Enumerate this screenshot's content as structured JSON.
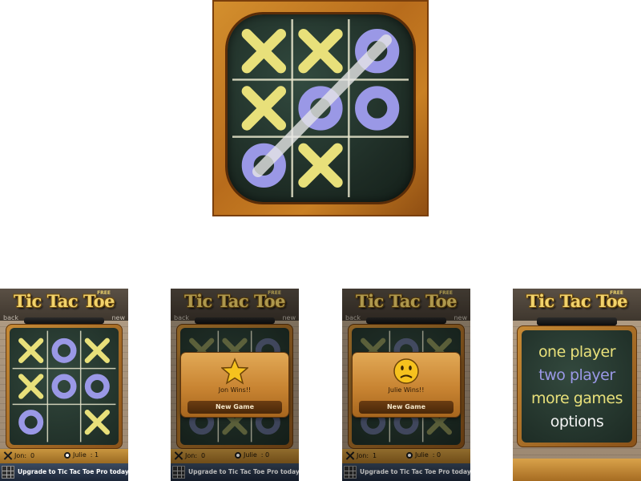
{
  "colors": {
    "x_color": "#e8e07a",
    "o_color": "#9a98e6",
    "chalk_line": "#e8e6cc",
    "board_green": "#22332a"
  },
  "app_icon": {
    "board": [
      "X",
      "X",
      "O",
      "X",
      "O",
      "O",
      "O",
      "X",
      ""
    ],
    "win_line": "diagonal-top-right-to-bottom-left"
  },
  "screen_game": {
    "logo": "Tic Tac Toe",
    "badge": "FREE",
    "nav_back": "back",
    "nav_new": "new",
    "board": [
      "X",
      "O",
      "X",
      "X",
      "O",
      "O",
      "O",
      "",
      "X"
    ],
    "player1": {
      "name": "Jon:",
      "score": "0"
    },
    "player2": {
      "name": "Julie",
      "score": ": 1"
    },
    "upgrade_text": "Upgrade to Tic Tac Toe Pro today!"
  },
  "screen_jon_wins": {
    "logo": "Tic Tac Toe",
    "badge": "FREE",
    "nav_back": "back",
    "nav_new": "new",
    "message": "Jon Wins!!",
    "button": "New Game",
    "icon": "star-icon",
    "player1": {
      "name": "Jon:",
      "score": "0"
    },
    "player2": {
      "name": "Julie",
      "score": ": 0"
    },
    "upgrade_text": "Upgrade to Tic Tac Toe Pro today!"
  },
  "screen_julie_wins": {
    "logo": "Tic Tac Toe",
    "badge": "FREE",
    "nav_back": "back",
    "nav_new": "new",
    "message": "Julie   Wins!!",
    "button": "New Game",
    "icon": "sad-face-icon",
    "player1": {
      "name": "Jon:",
      "score": "1"
    },
    "player2": {
      "name": "Julie",
      "score": ": 0"
    },
    "upgrade_text": "Upgrade to Tic Tac Toe Pro today!"
  },
  "screen_menu": {
    "logo": "Tic Tac Toe",
    "badge": "FREE",
    "items": [
      {
        "label": "one player",
        "color": "#e8e07a"
      },
      {
        "label": "two player",
        "color": "#9a98e6"
      },
      {
        "label": "more games",
        "color": "#e8e07a"
      },
      {
        "label": "options",
        "color": "#f2f2f2"
      }
    ]
  }
}
